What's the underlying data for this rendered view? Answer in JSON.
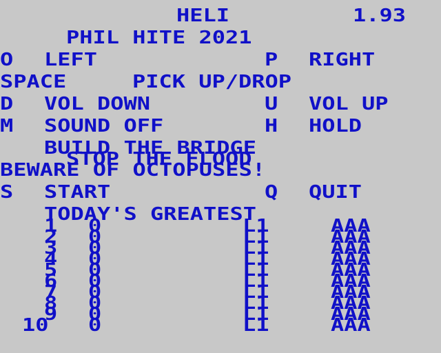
{
  "header": {
    "game_title": "HELI",
    "version": "1.93",
    "credit": "PHIL HITE 2021"
  },
  "controls": {
    "left_key": "O",
    "left_label": "LEFT",
    "right_key": "P",
    "right_label": "RIGHT",
    "pick_key": "SPACE",
    "pick_label": "PICK UP/DROP",
    "vol_down_key": "D",
    "vol_down_label": "VOL DOWN",
    "vol_up_key": "U",
    "vol_up_label": "VOL UP",
    "sound_key": "M",
    "sound_label": "SOUND OFF",
    "hold_key": "H",
    "hold_label": "HOLD"
  },
  "mission": {
    "line1": "BUILD THE BRIDGE",
    "line2": "STOP THE FLOOD",
    "line3": "BEWARE OF OCTOPUSES!"
  },
  "menu": {
    "start_key": "S",
    "start_label": "START",
    "quit_key": "Q",
    "quit_label": "QUIT"
  },
  "high_scores": {
    "title": "TODAY'S GREATEST",
    "entries": [
      {
        "rank": "1",
        "score": "0",
        "level": "L1",
        "name": "AAA"
      },
      {
        "rank": "2",
        "score": "0",
        "level": "L1",
        "name": "AAA"
      },
      {
        "rank": "3",
        "score": "0",
        "level": "L1",
        "name": "AAA"
      },
      {
        "rank": "4",
        "score": "0",
        "level": "L1",
        "name": "AAA"
      },
      {
        "rank": "5",
        "score": "0",
        "level": "L1",
        "name": "AAA"
      },
      {
        "rank": "6",
        "score": "0",
        "level": "L1",
        "name": "AAA"
      },
      {
        "rank": "7",
        "score": "0",
        "level": "L1",
        "name": "AAA"
      },
      {
        "rank": "8",
        "score": "0",
        "level": "L1",
        "name": "AAA"
      },
      {
        "rank": "9",
        "score": "0",
        "level": "L1",
        "name": "AAA"
      },
      {
        "rank": "10",
        "score": "0",
        "level": "L1",
        "name": "AAA"
      }
    ]
  },
  "colors": {
    "background": "#c8c8c8",
    "text": "#1010c8"
  }
}
